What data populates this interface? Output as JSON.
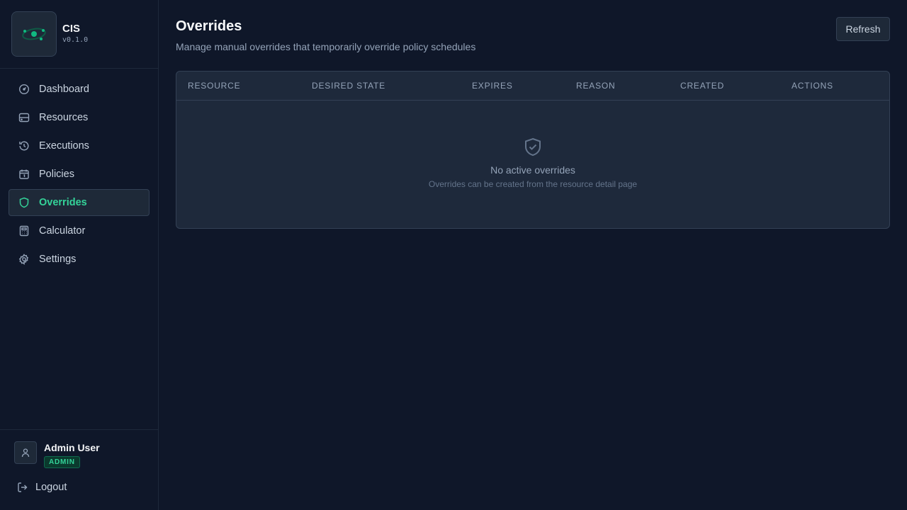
{
  "brand": {
    "name": "CIS",
    "version": "v0.1.0"
  },
  "nav": [
    {
      "label": "Dashboard",
      "icon": "gauge-icon"
    },
    {
      "label": "Resources",
      "icon": "server-icon"
    },
    {
      "label": "Executions",
      "icon": "history-icon"
    },
    {
      "label": "Policies",
      "icon": "calendar-icon"
    },
    {
      "label": "Overrides",
      "icon": "shield-icon",
      "active": true
    },
    {
      "label": "Calculator",
      "icon": "calculator-icon"
    },
    {
      "label": "Settings",
      "icon": "gear-icon"
    }
  ],
  "user": {
    "name": "Admin User",
    "role": "ADMIN",
    "logout_label": "Logout"
  },
  "page": {
    "title": "Overrides",
    "subtitle": "Manage manual overrides that temporarily override policy schedules",
    "refresh_label": "Refresh"
  },
  "table": {
    "columns": [
      "Resource",
      "Desired State",
      "Expires",
      "Reason",
      "Created",
      "Actions"
    ],
    "empty_title": "No active overrides",
    "empty_subtitle": "Overrides can be created from the resource detail page"
  },
  "colors": {
    "accent": "#34d399",
    "background": "#0f1729",
    "card": "#1e293b"
  }
}
